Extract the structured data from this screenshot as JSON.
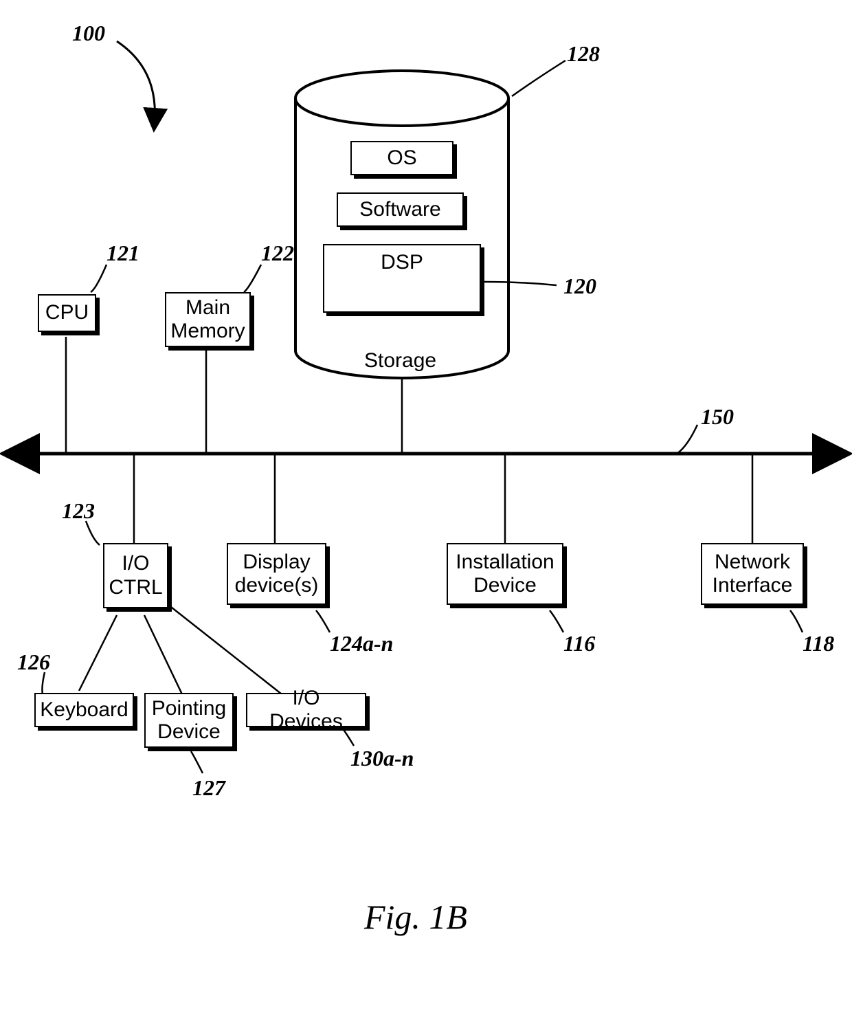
{
  "figure": {
    "caption": "Fig. 1B",
    "ref_main": "100",
    "bus_ref": "150"
  },
  "components": {
    "cpu": {
      "label": "CPU",
      "ref": "121"
    },
    "main_memory": {
      "label": "Main\nMemory",
      "ref": "122"
    },
    "storage": {
      "label": "Storage",
      "ref": "128"
    },
    "os": {
      "label": "OS"
    },
    "software": {
      "label": "Software"
    },
    "dsp": {
      "label": "DSP",
      "ref": "120"
    },
    "io_ctrl": {
      "label": "I/O\nCTRL",
      "ref": "123"
    },
    "display": {
      "label": "Display\ndevice(s)",
      "ref": "124a-n"
    },
    "install": {
      "label": "Installation\nDevice",
      "ref": "116"
    },
    "network": {
      "label": "Network\nInterface",
      "ref": "118"
    },
    "keyboard": {
      "label": "Keyboard",
      "ref": "126"
    },
    "pointing": {
      "label": "Pointing\nDevice",
      "ref": "127"
    },
    "io_devices": {
      "label": "I/O Devices",
      "ref": "130a-n"
    }
  }
}
